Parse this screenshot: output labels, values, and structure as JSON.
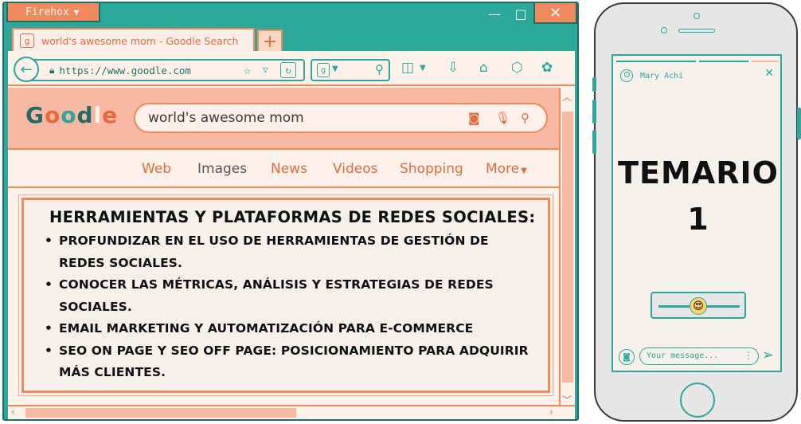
{
  "browser": {
    "app_name": "Firehox",
    "window_controls": {
      "minimize": "—",
      "maximize": "□",
      "close": "✕"
    },
    "tab": {
      "title": "world's awesome mom - Goodle Search",
      "favicon": "g"
    },
    "new_tab": "+",
    "url": "https://www.goodle.com",
    "search_engine_icon": "g"
  },
  "search_page": {
    "logo": [
      "G",
      "o",
      "o",
      "d",
      "l",
      "e"
    ],
    "query": "world's awesome mom",
    "tabs": [
      "Web",
      "Images",
      "News",
      "Videos",
      "Shopping",
      "More"
    ],
    "active_tab_index": 1
  },
  "content": {
    "heading": "HERRAMIENTAS Y PLATAFORMAS DE REDES SOCIALES:",
    "items": [
      "PROFUNDIZAR EN EL USO DE HERRAMIENTAS DE GESTIÓN DE REDES SOCIALES.",
      "CONOCER LAS MÉTRICAS, ANÁLISIS Y ESTRATEGIAS DE REDES SOCIALES.",
      "EMAIL MARKETING Y AUTOMATIZACIÓN PARA E-COMMERCE",
      "SEO ON PAGE Y SEO OFF PAGE: POSICIONAMIENTO PARA ADQUIRIR MÁS CLIENTES."
    ]
  },
  "phone": {
    "user_name": "Mary Achi",
    "story_title": "TEMARIO",
    "story_number": "1",
    "message_placeholder": "Your message...",
    "emoji": "😍"
  },
  "colors": {
    "teal": "#2aa89a",
    "coral": "#f08a5d",
    "peach": "#f8b8a2",
    "cream": "#fdf1ea"
  }
}
